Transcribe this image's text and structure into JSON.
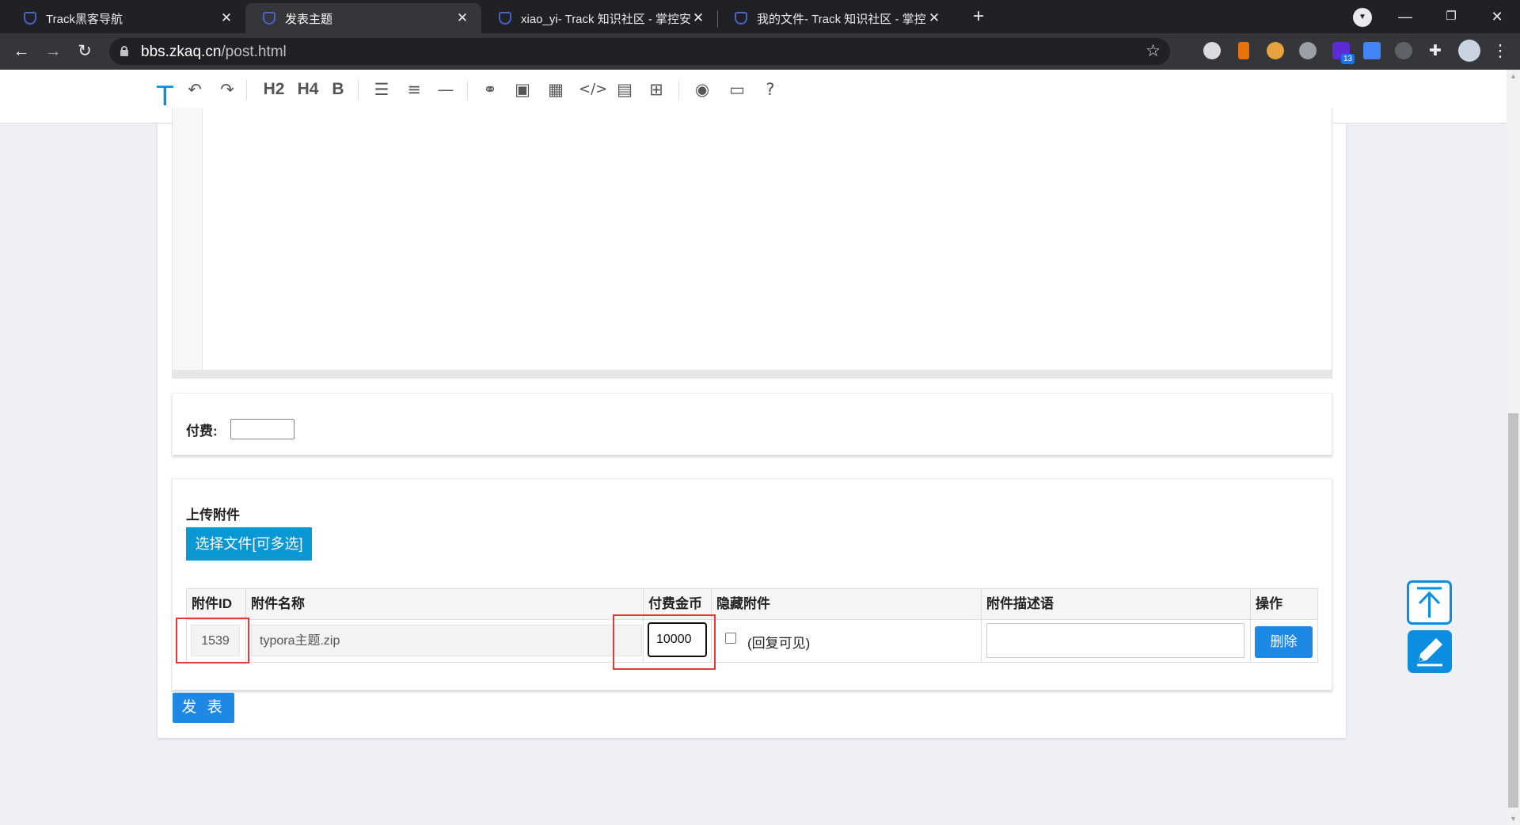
{
  "browser": {
    "tabs": [
      {
        "title": "Track黑客导航",
        "active": false
      },
      {
        "title": "发表主题",
        "active": true
      },
      {
        "title": "xiao_yi- Track 知识社区 - 掌控安",
        "active": false
      },
      {
        "title": "我的文件- Track 知识社区 - 掌控",
        "active": false
      }
    ],
    "url_domain": "bbs.zkaq.cn",
    "url_path": "/post.html",
    "extension_badge": "13"
  },
  "editor": {
    "logo": "T",
    "toolbar": {
      "h2": "H2",
      "h4": "H4",
      "bold": "B"
    }
  },
  "fee": {
    "label": "付费:",
    "value": ""
  },
  "upload": {
    "title": "上传附件",
    "choose_button": "选择文件[可多选]",
    "columns": [
      "附件ID",
      "附件名称",
      "付费金币",
      "隐藏附件",
      "附件描述语",
      "操作"
    ],
    "rows": [
      {
        "id": "1539",
        "name": "typora主题.zip",
        "coins": "10000",
        "hidden_label": "(回复可见)",
        "hidden_checked": false,
        "description": "",
        "action": "删除"
      }
    ]
  },
  "publish_button": "发 表",
  "colors": {
    "accent": "#1e88e5",
    "choose_button": "#0998d4",
    "highlight": "#e53935",
    "float_icon": "#0b8ee0"
  }
}
